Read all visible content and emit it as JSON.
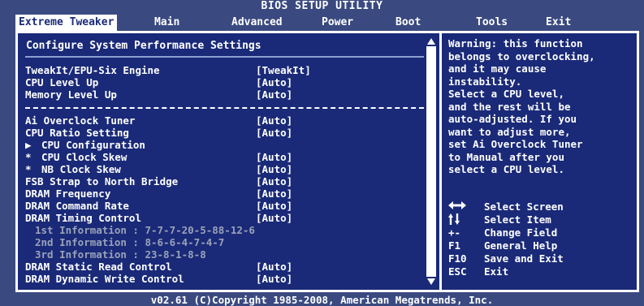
{
  "title": "BIOS SETUP UTILITY",
  "tabs": [
    {
      "label": "Extreme Tweaker",
      "active": true
    },
    {
      "label": "Main"
    },
    {
      "label": "Advanced"
    },
    {
      "label": "Power"
    },
    {
      "label": "Boot"
    },
    {
      "label": "Tools"
    },
    {
      "label": "Exit"
    }
  ],
  "section_title": "Configure System Performance Settings",
  "settings": [
    {
      "label": "TweakIt/EPU-Six Engine",
      "value": "[TweakIt]"
    },
    {
      "label": "CPU Level Up",
      "value": "[Auto]"
    },
    {
      "label": "Memory Level Up",
      "value": "[Auto]"
    },
    {
      "label": "Ai Overclock Tuner",
      "value": "[Auto]"
    },
    {
      "label": "CPU Ratio Setting",
      "value": "[Auto]"
    },
    {
      "marker": "▶",
      "label": "CPU Configuration",
      "value": ""
    },
    {
      "marker": "*",
      "label": "CPU Clock Skew",
      "value": "[Auto]"
    },
    {
      "marker": "*",
      "label": "NB Clock Skew",
      "value": "[Auto]"
    },
    {
      "label": "FSB Strap to North Bridge",
      "value": "[Auto]"
    },
    {
      "label": "DRAM Frequency",
      "value": "[Auto]"
    },
    {
      "label": "DRAM Command Rate",
      "value": "[Auto]"
    },
    {
      "label": "DRAM Timing Control",
      "value": "[Auto]"
    },
    {
      "label": "1st Information : 7-7-7-20-5-88-12-6",
      "value": ""
    },
    {
      "label": "2nd Information : 8-6-6-4-7-4-7",
      "value": ""
    },
    {
      "label": "3rd Information : 23-8-1-8-8",
      "value": ""
    },
    {
      "label": "DRAM Static Read Control",
      "value": "[Auto]"
    },
    {
      "label": "DRAM Dynamic Write Control",
      "value": "[Auto]"
    }
  ],
  "help_lines": [
    "Warning: this function",
    "belongs to overclocking,",
    "and it may cause",
    "instability.",
    "Select a CPU level,",
    "and the rest will be",
    "auto-adjusted. If you",
    "want to adjust more,",
    "set Ai Overclock Tuner",
    "to Manual after you",
    "select a CPU level."
  ],
  "keys": [
    {
      "key": "",
      "icon": "left-right-arrows-icon",
      "desc": "Select Screen"
    },
    {
      "key": "",
      "icon": "up-down-arrows-icon",
      "desc": "Select Item"
    },
    {
      "key": "+-",
      "desc": "Change Field"
    },
    {
      "key": "F1",
      "desc": "General Help"
    },
    {
      "key": "F10",
      "desc": "Save and Exit"
    },
    {
      "key": "ESC",
      "desc": "Exit"
    }
  ],
  "footer": "v02.61 (C)Copyright 1985-2008, American Megatrends, Inc.",
  "colors": {
    "background": "#3a4a80",
    "panel": "#1a2a78",
    "text": "#ffffff",
    "inactive_text": "#9aa2b8",
    "active_tab_bg": "#ffffff"
  }
}
